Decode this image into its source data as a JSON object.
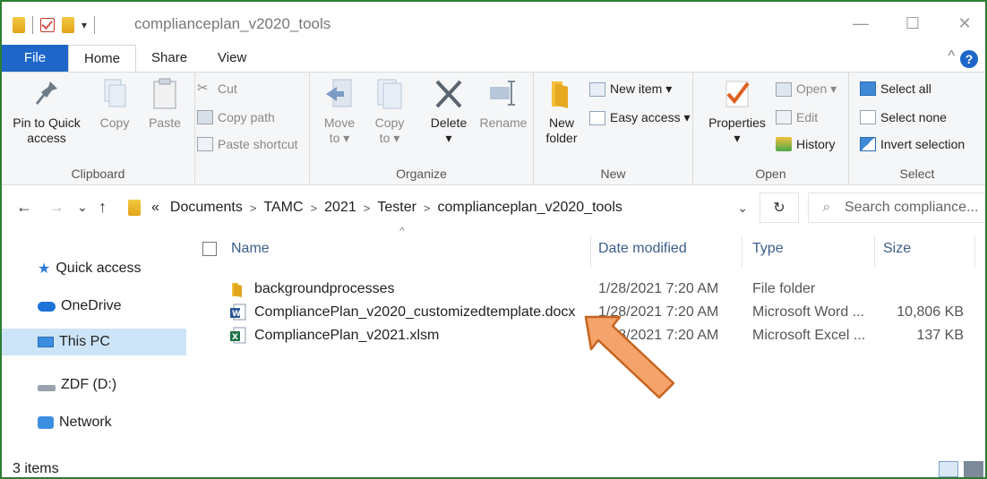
{
  "window": {
    "title": "complianceplan_v2020_tools",
    "minimize_glyph": "—",
    "maximize_glyph": "☐",
    "close_glyph": "✕"
  },
  "ribbon_tabs": {
    "file": "File",
    "home": "Home",
    "share": "Share",
    "view": "View",
    "help": "?",
    "collapse": "^"
  },
  "clipboard": {
    "pin_line1": "Pin to Quick",
    "pin_line2": "access",
    "copy": "Copy",
    "paste": "Paste",
    "cut": "Cut",
    "copy_path": "Copy path",
    "paste_shortcut": "Paste shortcut",
    "label": "Clipboard"
  },
  "organize": {
    "move_to": "Move",
    "move_to2": "to ▾",
    "copy_to": "Copy",
    "copy_to2": "to ▾",
    "delete": "Delete",
    "delete_drop": "▾",
    "rename": "Rename",
    "label": "Organize"
  },
  "new_group": {
    "new_folder1": "New",
    "new_folder2": "folder",
    "new_item": "New item ▾",
    "easy_access": "Easy access ▾",
    "label": "New"
  },
  "open_group": {
    "properties": "Properties",
    "properties_drop": "▾",
    "open": "Open ▾",
    "edit": "Edit",
    "history": "History",
    "label": "Open"
  },
  "select_group": {
    "select_all": "Select all",
    "select_none": "Select none",
    "invert": "Invert selection",
    "label": "Select"
  },
  "address": {
    "back": "←",
    "forward": "→",
    "recent": "⌄",
    "up": "↑",
    "overflow": "«",
    "crumbs": [
      "Documents",
      "TAMC",
      "2021",
      "Tester",
      "complianceplan_v2020_tools"
    ],
    "sep": ">",
    "dropdown": "⌄",
    "refresh": "↻",
    "search_placeholder": "Search compliance..."
  },
  "nav": {
    "quick_access": "Quick access",
    "onedrive": "OneDrive",
    "this_pc": "This PC",
    "zdf": "ZDF (D:)",
    "network": "Network"
  },
  "columns": {
    "name": "Name",
    "date": "Date modified",
    "type": "Type",
    "size": "Size",
    "sort_glyph": "^"
  },
  "files": [
    {
      "name": "backgroundprocesses",
      "date": "1/28/2021 7:20 AM",
      "type": "File folder",
      "size": "",
      "icon": "folder-icon"
    },
    {
      "name": "CompliancePlan_v2020_customizedtemplate.docx",
      "date": "1/28/2021 7:20 AM",
      "type": "Microsoft Word ...",
      "size": "10,806 KB",
      "icon": "word-icon"
    },
    {
      "name": "CompliancePlan_v2021.xlsm",
      "date": "1/28/2021 7:20 AM",
      "type": "Microsoft Excel ...",
      "size": "137 KB",
      "icon": "excel-icon"
    }
  ],
  "status": {
    "count": "3 items"
  },
  "colors": {
    "accent": "#1e66c8",
    "selection": "#cce4f7",
    "arrow_fill": "#f4a46b",
    "arrow_stroke": "#c8641e",
    "window_border": "#2f7d32"
  }
}
